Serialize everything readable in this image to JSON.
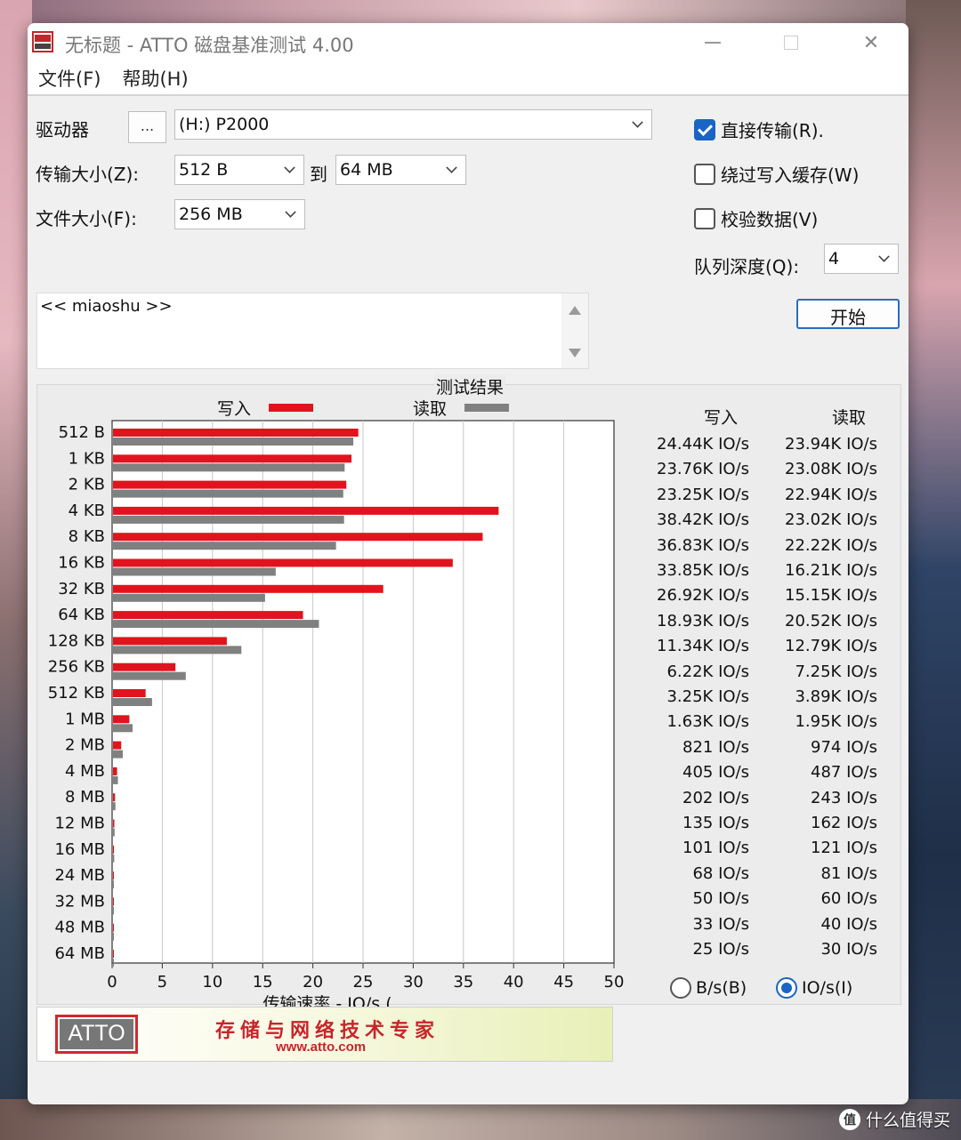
{
  "window": {
    "title": "无标题 - ATTO 磁盘基准测试 4.00",
    "icon": "atto-app-icon"
  },
  "menu": [
    {
      "label": "文件(F)"
    },
    {
      "label": "帮助(H)"
    }
  ],
  "settings": {
    "drive_label": "驱动器",
    "browse_label": "...",
    "drive_value": "(H:) P2000",
    "transfer_label": "传输大小(Z):",
    "transfer_from": "512 B",
    "to_label": "到",
    "transfer_to": "64 MB",
    "filesize_label": "文件大小(F):",
    "filesize_value": "256 MB",
    "direct_io": {
      "label": "直接传输(R).",
      "checked": true
    },
    "bypass_write_cache": {
      "label": "绕过写入缓存(W)",
      "checked": false
    },
    "verify_data": {
      "label": "校验数据(V)",
      "checked": false
    },
    "queue_depth_label": "队列深度(Q):",
    "queue_depth_value": "4",
    "start_label": "开始"
  },
  "description": {
    "text": "<< miaoshu >>"
  },
  "results": {
    "title": "测试结果",
    "write_col": "写入",
    "read_col": "读取",
    "unit_bs": {
      "label": "B/s(B)",
      "selected": false
    },
    "unit_ios": {
      "label": "IO/s(I)",
      "selected": true
    },
    "rows": [
      {
        "size": "512 B",
        "write": "24.44K IO/s",
        "read": "23.94K IO/s"
      },
      {
        "size": "1 KB",
        "write": "23.76K IO/s",
        "read": "23.08K IO/s"
      },
      {
        "size": "2 KB",
        "write": "23.25K IO/s",
        "read": "22.94K IO/s"
      },
      {
        "size": "4 KB",
        "write": "38.42K IO/s",
        "read": "23.02K IO/s"
      },
      {
        "size": "8 KB",
        "write": "36.83K IO/s",
        "read": "22.22K IO/s"
      },
      {
        "size": "16 KB",
        "write": "33.85K IO/s",
        "read": "16.21K IO/s"
      },
      {
        "size": "32 KB",
        "write": "26.92K IO/s",
        "read": "15.15K IO/s"
      },
      {
        "size": "64 KB",
        "write": "18.93K IO/s",
        "read": "20.52K IO/s"
      },
      {
        "size": "128 KB",
        "write": "11.34K IO/s",
        "read": "12.79K IO/s"
      },
      {
        "size": "256 KB",
        "write": "6.22K IO/s",
        "read": "7.25K IO/s"
      },
      {
        "size": "512 KB",
        "write": "3.25K IO/s",
        "read": "3.89K IO/s"
      },
      {
        "size": "1 MB",
        "write": "1.63K IO/s",
        "read": "1.95K IO/s"
      },
      {
        "size": "2 MB",
        "write": "821 IO/s",
        "read": "974 IO/s"
      },
      {
        "size": "4 MB",
        "write": "405 IO/s",
        "read": "487 IO/s"
      },
      {
        "size": "8 MB",
        "write": "202 IO/s",
        "read": "243 IO/s"
      },
      {
        "size": "12 MB",
        "write": "135 IO/s",
        "read": "162 IO/s"
      },
      {
        "size": "16 MB",
        "write": "101 IO/s",
        "read": "121 IO/s"
      },
      {
        "size": "24 MB",
        "write": "68 IO/s",
        "read": "81 IO/s"
      },
      {
        "size": "32 MB",
        "write": "50 IO/s",
        "read": "60 IO/s"
      },
      {
        "size": "48 MB",
        "write": "33 IO/s",
        "read": "40 IO/s"
      },
      {
        "size": "64 MB",
        "write": "25 IO/s",
        "read": "30 IO/s"
      }
    ]
  },
  "chart_data": {
    "type": "bar",
    "orientation": "horizontal",
    "categories": [
      "512 B",
      "1 KB",
      "2 KB",
      "4 KB",
      "8 KB",
      "16 KB",
      "32 KB",
      "64 KB",
      "128 KB",
      "256 KB",
      "512 KB",
      "1 MB",
      "2 MB",
      "4 MB",
      "8 MB",
      "12 MB",
      "16 MB",
      "24 MB",
      "32 MB",
      "48 MB",
      "64 MB"
    ],
    "series": [
      {
        "name": "写入",
        "color": "#e0141e",
        "values": [
          24.44,
          23.76,
          23.25,
          38.42,
          36.83,
          33.85,
          26.92,
          18.93,
          11.34,
          6.22,
          3.25,
          1.63,
          0.821,
          0.405,
          0.202,
          0.135,
          0.101,
          0.068,
          0.05,
          0.033,
          0.025
        ]
      },
      {
        "name": "读取",
        "color": "#808080",
        "values": [
          23.94,
          23.08,
          22.94,
          23.02,
          22.22,
          16.21,
          15.15,
          20.52,
          12.79,
          7.25,
          3.89,
          1.95,
          0.974,
          0.487,
          0.243,
          0.162,
          0.121,
          0.081,
          0.06,
          0.04,
          0.03
        ]
      }
    ],
    "xlabel": "传输速率 - IO/s (",
    "xticks": [
      "0",
      "5",
      "10",
      "15",
      "20",
      "25",
      "30",
      "35",
      "40",
      "45",
      "50"
    ],
    "xlim": [
      0,
      50
    ],
    "grid": true,
    "legend": "top"
  },
  "banner": {
    "logo": "ATTO",
    "slogan": "存储与网络技术专家",
    "url": "www.atto.com"
  },
  "watermark": {
    "icon": "值",
    "text": "什么值得买"
  }
}
